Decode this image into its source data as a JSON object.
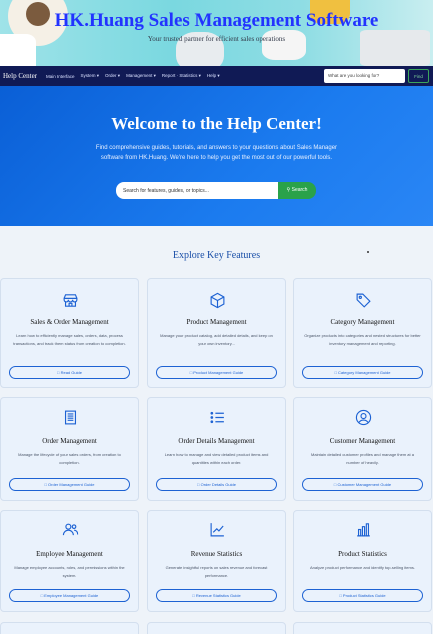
{
  "banner": {
    "title": "HK.Huang Sales Management Software",
    "tagline": "Your trusted partner for efficient sales operations"
  },
  "nav": {
    "brand": "Help Center",
    "items": [
      "Main Interface",
      "System ▾",
      "Order ▾",
      "Management ▾",
      "Report · Statistics ▾",
      "Help ▾"
    ],
    "search_placeholder": "What are you looking for?",
    "find_label": "Find"
  },
  "hero": {
    "title": "Welcome to the Help Center!",
    "description": "Find comprehensive guides, tutorials, and answers to your questions about Sales Manager software from HK.Huang. We're here to help you get the most out of our powerful tools.",
    "search_placeholder": "Search for features, guides, or topics...",
    "search_button": "Search"
  },
  "features": {
    "title": "Explore Key Features",
    "cards": [
      {
        "icon": "store-icon",
        "title": "Sales & Order Management",
        "desc": "Learn how to efficiently manage sales, orders, data, process transactions, and track them status from creation to completion.",
        "button": "Read Guide"
      },
      {
        "icon": "box-icon",
        "title": "Product Management",
        "desc": "Manage your product catalog, add detailed details, and keep on your own inventory...",
        "button": "Product Management Guide"
      },
      {
        "icon": "tag-icon",
        "title": "Category Management",
        "desc": "Organize products into categories and nested structures for better inventory management and reporting.",
        "button": "Category Management Guide"
      },
      {
        "icon": "receipt-icon",
        "title": "Order Management",
        "desc": "Manage the lifecycle of your sales orders, from creation to completion.",
        "button": "Order Management Guide"
      },
      {
        "icon": "list-icon",
        "title": "Order Details Management",
        "desc": "Learn how to manage and view detailed product items and quantities within each order.",
        "button": "Order Details Guide"
      },
      {
        "icon": "user-icon",
        "title": "Customer Management",
        "desc": "Maintain detailed customer profiles and manage them at a number of heavily.",
        "button": "Customer Management Guide"
      },
      {
        "icon": "users-icon",
        "title": "Employee Management",
        "desc": "Manage employee accounts, roles, and permissions within the system.",
        "button": "Employee Management Guide"
      },
      {
        "icon": "trend-icon",
        "title": "Revenue Statistics",
        "desc": "Generate insightful reports on sales revenue and forecast performance.",
        "button": "Revenue Statistics Guide"
      },
      {
        "icon": "bar-chart-icon",
        "title": "Product Statistics",
        "desc": "Analyze product performance and identify top-selling items.",
        "button": "Product Statistics Guide"
      }
    ]
  },
  "colors": {
    "nav_bg": "#101a55",
    "hero_bg": "#1b7bef",
    "accent": "#1d62d3",
    "search_button": "#2aa24a"
  }
}
